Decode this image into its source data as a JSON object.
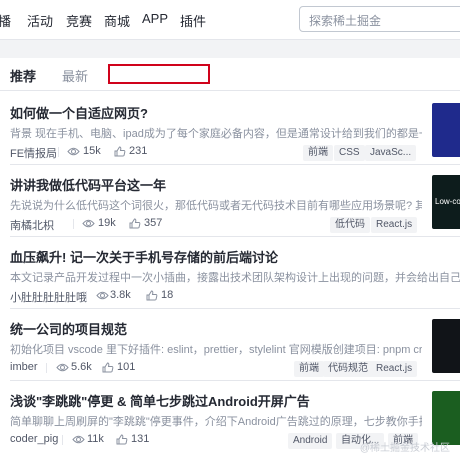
{
  "nav": {
    "items": [
      "播",
      "活动",
      "竞赛",
      "商城",
      "APP",
      "插件"
    ]
  },
  "search": {
    "placeholder": "探索稀土掘金"
  },
  "tabs": {
    "recommend": "推荐",
    "latest": "最新"
  },
  "colors": {
    "accent": "#1e80ff",
    "annotation_box": "#d0021b"
  },
  "articles": [
    {
      "title": "如何做一个自适应网页?",
      "excerpt": "背景 现在手机、电脑、ipad成为了每个家庭必备内容，但是通常设计给到我们的都是一个固...",
      "author": "FE情报局",
      "views": "15k",
      "likes": "231",
      "tags": [
        "前端",
        "CSS",
        "JavaSc..."
      ]
    },
    {
      "title": "讲讲我做低代码平台这一年",
      "excerpt": "先说说为什么低代码这个词很火，那低代码或者无代码技术目前有哪些应用场景呢? 其底层的...",
      "author": "南橘北枳",
      "views": "19k",
      "likes": "357",
      "tags": [
        "低代码",
        "React.js"
      ],
      "thumb_text": "Low-code"
    },
    {
      "title": "血压飙升! 记一次关于手机号存储的前后端讨论",
      "excerpt": "本文记录产品开发过程中一次小插曲，接露出技术团队架构设计上出现的问题，并会给出自己的分析和相应",
      "author": "小肚肚肚肚肚哦",
      "views": "3.8k",
      "likes": "18",
      "tags": []
    },
    {
      "title": "统一公司的项目规范",
      "excerpt": "初始化项目 vscode 里下好插件: eslint，prettier，stylelint 官网模版创建项目: pnpm creat...",
      "author": "imber",
      "views": "5.6k",
      "likes": "101",
      "tags": [
        "前端",
        "代码规范",
        "React.js"
      ]
    },
    {
      "title": "浅谈\"李跳跳\"停更 & 简单七步跳过Android开屏广告",
      "excerpt": "简单聊聊上周刷屏的\"李跳跳\"停更事件，介绍下Android广告跳过的原理，七步教你手把手...",
      "author": "coder_pig",
      "views": "11k",
      "likes": "131",
      "tags": [
        "Android",
        "自动化...",
        "前端"
      ]
    }
  ],
  "watermark": "@稀土掘金技术社区"
}
